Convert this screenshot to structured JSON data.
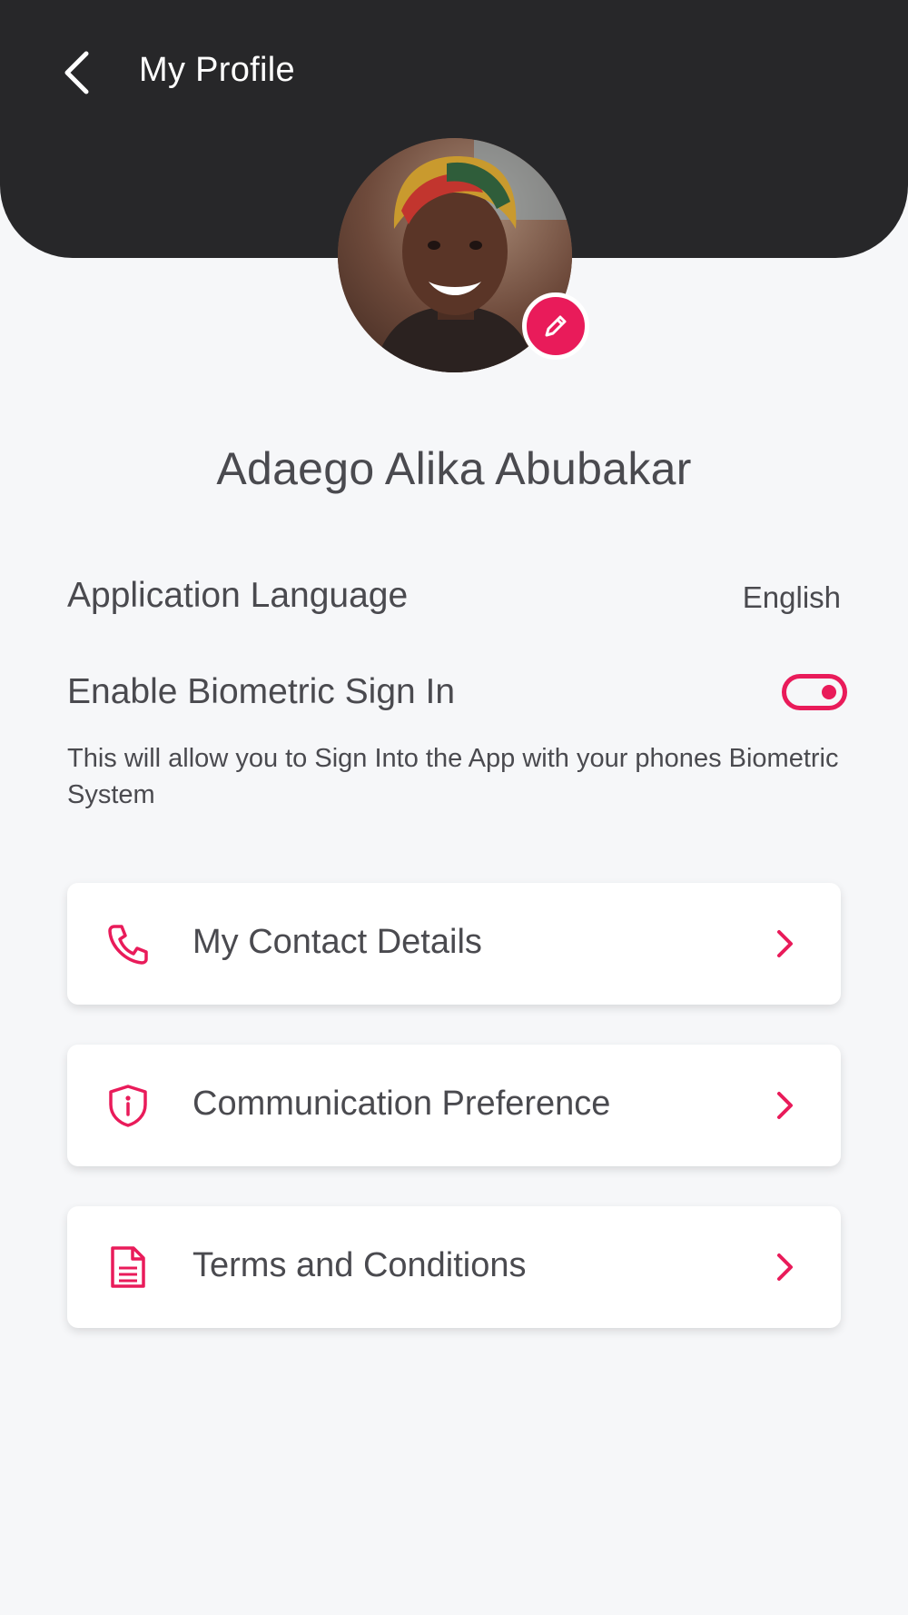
{
  "header": {
    "title": "My Profile",
    "back_icon": "chevron-left-icon"
  },
  "profile": {
    "name": "Adaego Alika Abubakar",
    "edit_icon": "pencil-icon"
  },
  "settings": {
    "language_label": "Application Language",
    "language_value": "English",
    "biometric_label": "Enable Biometric Sign In",
    "biometric_enabled": true,
    "biometric_description": "This will allow you to Sign Into the App with your phones Biometric System"
  },
  "menu": [
    {
      "label": "My Contact Details",
      "icon": "phone-icon"
    },
    {
      "label": "Communication Preference",
      "icon": "shield-info-icon"
    },
    {
      "label": "Terms and Conditions",
      "icon": "document-icon"
    }
  ],
  "colors": {
    "accent": "#e91b5a",
    "header_bg": "#272729",
    "page_bg": "#f6f7f9",
    "text": "#4a4a4f"
  }
}
